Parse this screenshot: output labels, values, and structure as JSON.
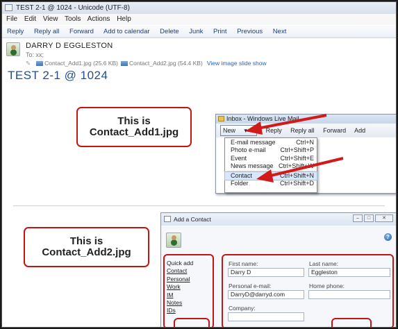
{
  "window": {
    "title": "TEST 2-1 @ 1024 - Unicode (UTF-8)"
  },
  "menubar": [
    "File",
    "Edit",
    "View",
    "Tools",
    "Actions",
    "Help"
  ],
  "toolbar": [
    "Reply",
    "Reply all",
    "Forward",
    "Add to calendar",
    "Delete",
    "Junk",
    "Print",
    "Previous",
    "Next"
  ],
  "message": {
    "sender": "DARRY D EGGLESTON",
    "to": "To:  xx;",
    "attachments": [
      {
        "name": "Contact_Add1.jpg (25.6 KB)"
      },
      {
        "name": "Contact_Add2.jpg (54.4 KB)"
      }
    ],
    "slideshow_link": "View image slide show",
    "subject": "TEST 2-1 @ 1024"
  },
  "callouts": {
    "first": {
      "line1": "This is",
      "line2": "Contact_Add1.jpg"
    },
    "second": {
      "line1": "This is",
      "line2": "Contact_Add2.jpg"
    }
  },
  "inbox_popup": {
    "title": "Inbox - Windows Live Mail",
    "new_button": "New",
    "toolbar": [
      "Reply",
      "Reply all",
      "Forward",
      "Add"
    ],
    "menu": [
      {
        "label": "E-mail message",
        "shortcut": "Ctrl+N"
      },
      {
        "label": "Photo e-mail",
        "shortcut": "Ctrl+Shift+P"
      },
      {
        "label": "Event",
        "shortcut": "Ctrl+Shift+E"
      },
      {
        "label": "News message",
        "shortcut": "Ctrl+Shift+W"
      },
      {
        "label": "Contact",
        "shortcut": "Ctrl+Shift+N"
      },
      {
        "label": "Folder",
        "shortcut": "Ctrl+Shift+D"
      }
    ]
  },
  "add_contact_dialog": {
    "title": "Add a Contact",
    "sidebar": [
      "Quick add",
      "Contact",
      "Personal",
      "Work",
      "IM",
      "Notes",
      "IDs"
    ],
    "fields": {
      "first_name_label": "First name:",
      "first_name_value": "Darry D",
      "last_name_label": "Last name:",
      "last_name_value": "Eggleston",
      "email_label": "Personal e-mail:",
      "email_value": "DarryD@darryd.com",
      "home_phone_label": "Home phone:",
      "home_phone_value": "",
      "company_label": "Company:",
      "company_value": ""
    },
    "help_icon": "?"
  },
  "colors": {
    "callout_border": "#c41414",
    "subject": "#1f4f8d",
    "link": "#2a62b8"
  }
}
